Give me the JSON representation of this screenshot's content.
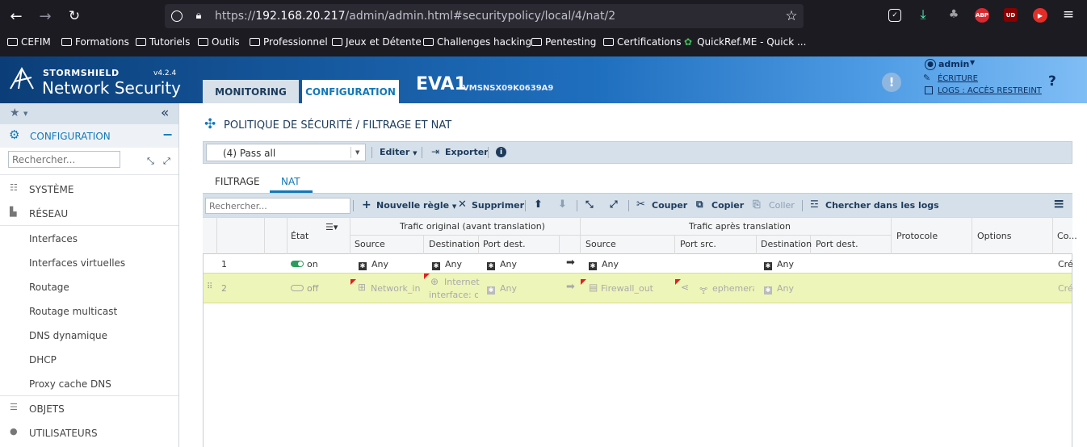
{
  "browser": {
    "url_prefix": "https://",
    "url_host": "192.168.20.217",
    "url_path": "/admin/admin.html#securitypolicy/local/4/nat/2"
  },
  "bookmarks": [
    "CEFIM",
    "Formations",
    "Tutoriels",
    "Outils",
    "Professionnel",
    "Jeux et Détente",
    "Challenges hacking",
    "Pentesting",
    "Certifications",
    "QuickRef.ME - Quick ..."
  ],
  "extensions": {
    "abp": "ABP",
    "ud": "UD"
  },
  "header": {
    "brand_small": "STORMSHIELD",
    "brand_big": "Network Security",
    "version": "v4.2.4",
    "tab_monitoring": "MONITORING",
    "tab_configuration": "CONFIGURATION",
    "device": "EVA1",
    "serial": "VMSNSX09K0639A9",
    "user": "admin",
    "write": "ÉCRITURE",
    "logs": "LOGS : ACCÈS RESTREINT",
    "help": "?"
  },
  "sidebar": {
    "section": "CONFIGURATION",
    "search_placeholder": "Rechercher...",
    "systeme": "SYSTÈME",
    "reseau": "RÉSEAU",
    "items": [
      "Interfaces",
      "Interfaces virtuelles",
      "Routage",
      "Routage multicast",
      "DNS dynamique",
      "DHCP",
      "Proxy cache DNS"
    ],
    "objets": "OBJETS",
    "utilisateurs": "UTILISATEURS"
  },
  "page": {
    "title": "POLITIQUE DE SÉCURITÉ / FILTRAGE ET NAT",
    "policy_select": "(4) Pass all",
    "editer": "Editer",
    "exporter": "Exporter",
    "tab_filtrage": "FILTRAGE",
    "tab_nat": "NAT"
  },
  "toolbar": {
    "search_placeholder": "Rechercher...",
    "new_rule": "Nouvelle règle",
    "delete": "Supprimer",
    "cut": "Couper",
    "copy": "Copier",
    "paste": "Coller",
    "search_logs": "Chercher dans les logs"
  },
  "table": {
    "etat": "État",
    "group_orig": "Trafic original (avant translation)",
    "group_after": "Trafic après translation",
    "source": "Source",
    "destination": "Destination",
    "port_dest": "Port dest.",
    "source2": "Source",
    "port_src": "Port src.",
    "destination2": "Destination",
    "port_dest2": "Port dest.",
    "protocole": "Protocole",
    "options": "Options",
    "co": "Co...",
    "rows": [
      {
        "num": "1",
        "state": "on",
        "src": "Any",
        "dst": "Any",
        "pdst": "Any",
        "src2": "Any",
        "psrc": "",
        "dst2": "Any",
        "pdst2": "",
        "comment": "Cré"
      },
      {
        "num": "2",
        "state": "off",
        "src": "Network_in",
        "dst_line1": "Internet",
        "dst_line2": "interface: ou",
        "pdst": "Any",
        "src2": "Firewall_out",
        "psrc": "ephemera",
        "dst2": "Any",
        "pdst2": "",
        "comment": "Cré"
      }
    ]
  }
}
